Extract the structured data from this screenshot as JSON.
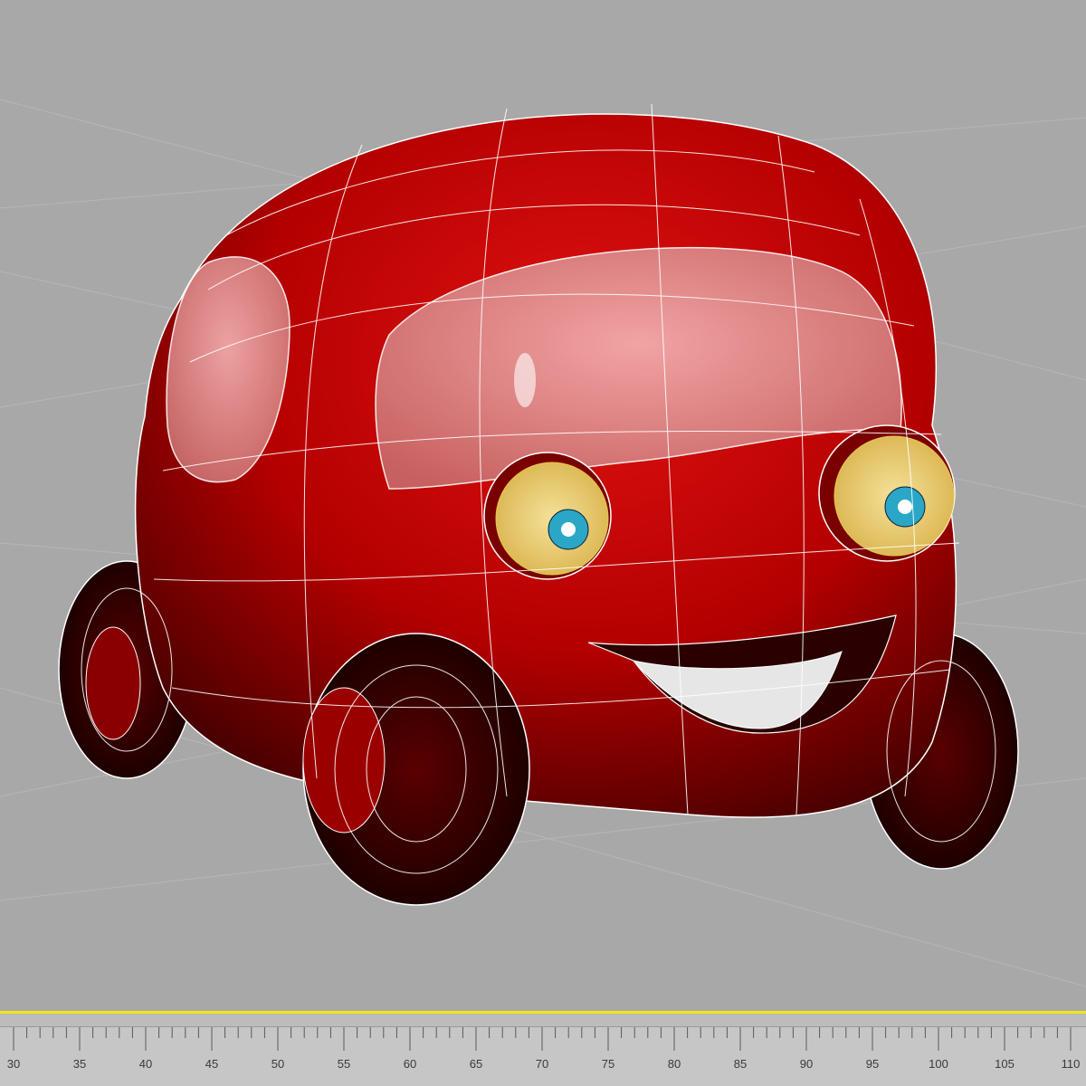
{
  "viewport": {
    "background_color": "#a8a8a8",
    "grid_color": "#b9b9b9",
    "object": {
      "body_color": "#c40000",
      "shadow_color": "#3a0000",
      "wireframe_color": "#ffffff",
      "eye_color": "#f2d26a",
      "iris_color": "#2aa7c6",
      "teeth_color": "#e6e6e6"
    }
  },
  "timeline": {
    "accent_color": "#f2e61a",
    "ticks": [
      "30",
      "35",
      "40",
      "45",
      "50",
      "55",
      "60",
      "65",
      "70",
      "75",
      "80",
      "85",
      "90",
      "95",
      "100",
      "105",
      "110"
    ]
  }
}
